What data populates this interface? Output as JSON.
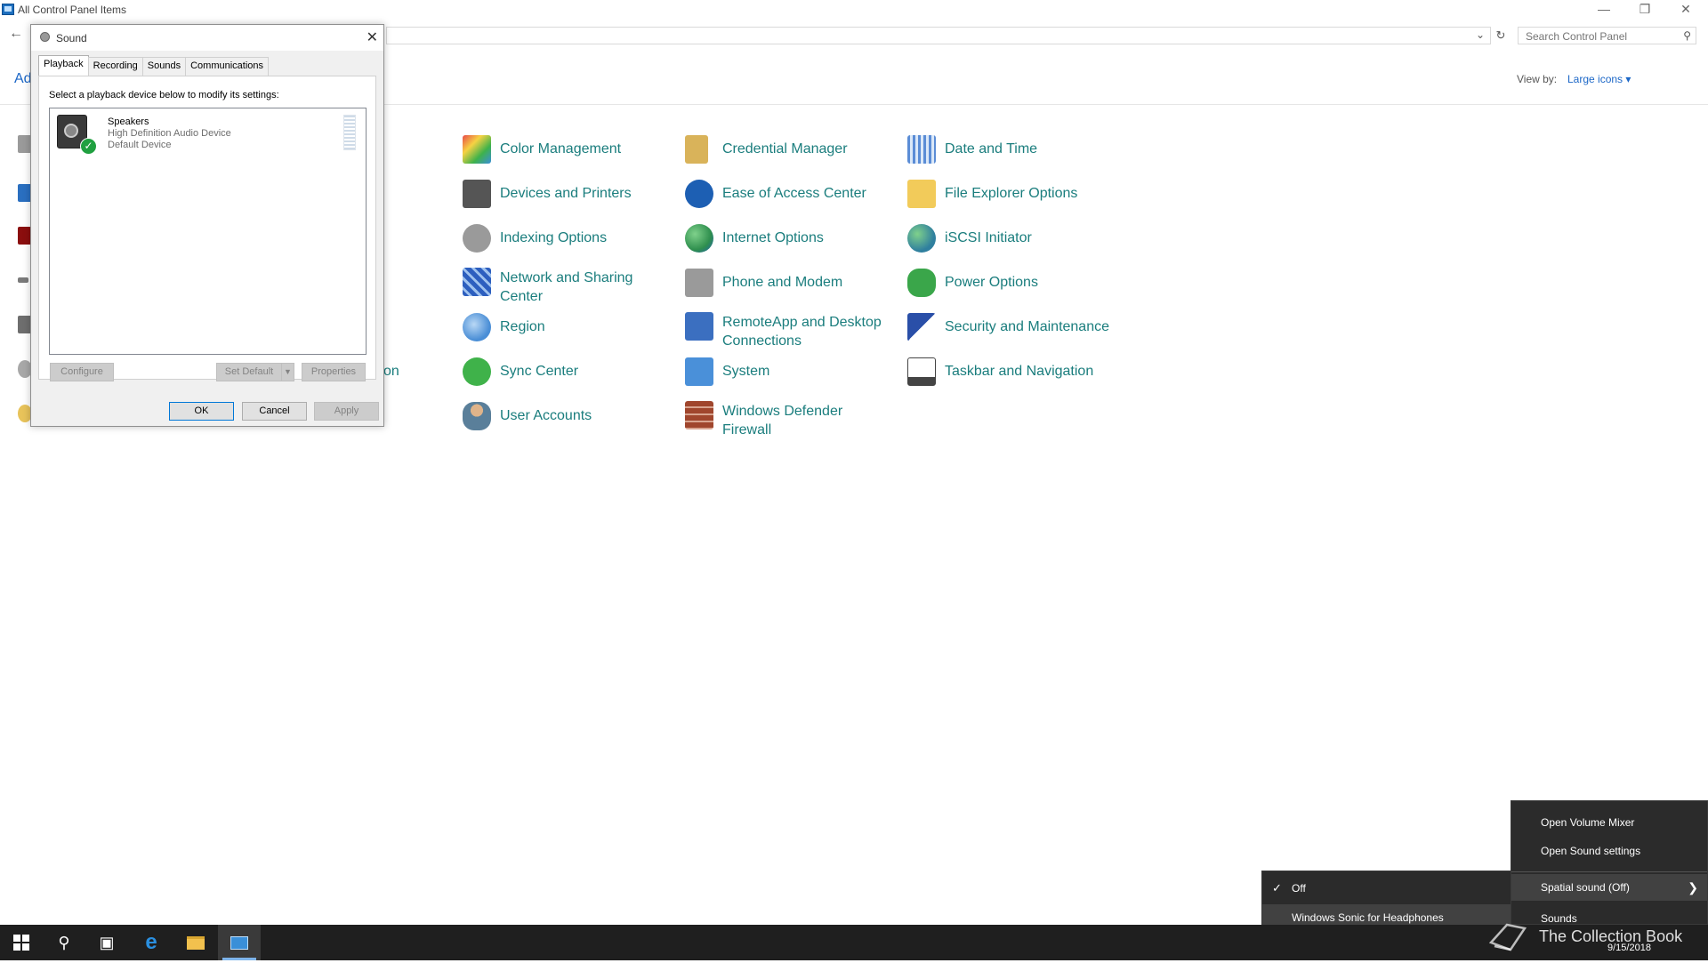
{
  "window": {
    "title": "All Control Panel Items",
    "adjust_label_partial": "Ad",
    "search_placeholder": "Search Control Panel",
    "view_by_label": "View by:",
    "view_by_value": "Large icons ▾"
  },
  "control_panel_items": [
    {
      "label": "Color Management",
      "icon": "color-management-icon",
      "color": "#3a8fd8"
    },
    {
      "label": "Credential Manager",
      "icon": "credential-manager-icon",
      "color": "#c9a34a"
    },
    {
      "label": "Date and Time",
      "icon": "date-time-icon",
      "color": "#5b8dd6"
    },
    {
      "label": "Devices and Printers",
      "icon": "printer-icon",
      "color": "#555555"
    },
    {
      "label": "Ease of Access Center",
      "icon": "ease-of-access-icon",
      "color": "#1d5fb3"
    },
    {
      "label": "File Explorer Options",
      "icon": "folder-options-icon",
      "color": "#f2cb5a"
    },
    {
      "label": "Indexing Options",
      "icon": "indexing-icon",
      "color": "#8a8a8a"
    },
    {
      "label": "Internet Options",
      "icon": "internet-options-icon",
      "color": "#2f8f4e"
    },
    {
      "label": "iSCSI Initiator",
      "icon": "iscsi-icon",
      "color": "#2f7f9e"
    },
    {
      "label": "Network and Sharing Center",
      "icon": "network-icon",
      "color": "#2d5fbf"
    },
    {
      "label": "Phone and Modem",
      "icon": "phone-modem-icon",
      "color": "#7a7a7a"
    },
    {
      "label": "Power Options",
      "icon": "power-options-icon",
      "color": "#3aa64a"
    },
    {
      "label": "Region",
      "icon": "region-icon",
      "color": "#4a8ed6"
    },
    {
      "label": "RemoteApp and Desktop Connections",
      "icon": "remoteapp-icon",
      "color": "#3b6fc0"
    },
    {
      "label": "Security and Maintenance",
      "icon": "security-flag-icon",
      "color": "#2a4fa8"
    },
    {
      "label": "Sync Center",
      "icon": "sync-center-icon",
      "color": "#3fb24a"
    },
    {
      "label": "System",
      "icon": "system-icon",
      "color": "#4a90d9"
    },
    {
      "label": "Taskbar and Navigation",
      "icon": "taskbar-icon",
      "color": "#444444"
    },
    {
      "label": "User Accounts",
      "icon": "user-accounts-icon",
      "color": "#5a7f9a"
    },
    {
      "label": "Windows Defender Firewall",
      "icon": "firewall-icon",
      "color": "#a0462d"
    }
  ],
  "partial_label": "on",
  "sound_dialog": {
    "title": "Sound",
    "tabs": [
      "Playback",
      "Recording",
      "Sounds",
      "Communications"
    ],
    "active_tab": "Playback",
    "instruction": "Select a playback device below to modify its settings:",
    "device": {
      "name": "Speakers",
      "description": "High Definition Audio Device",
      "status": "Default Device"
    },
    "buttons": {
      "configure": "Configure",
      "set_default": "Set Default",
      "properties": "Properties",
      "ok": "OK",
      "cancel": "Cancel",
      "apply": "Apply"
    }
  },
  "volume_menu": {
    "items": [
      "Open Volume Mixer",
      "Open Sound settings",
      "Spatial sound (Off)",
      "Sounds"
    ],
    "highlighted": "Spatial sound (Off)"
  },
  "spatial_submenu": {
    "items": [
      "Off",
      "Windows Sonic for Headphones"
    ],
    "checked": "Off"
  },
  "taskbar": {
    "date": "9/15/2018"
  },
  "watermark": "The Collection Book"
}
